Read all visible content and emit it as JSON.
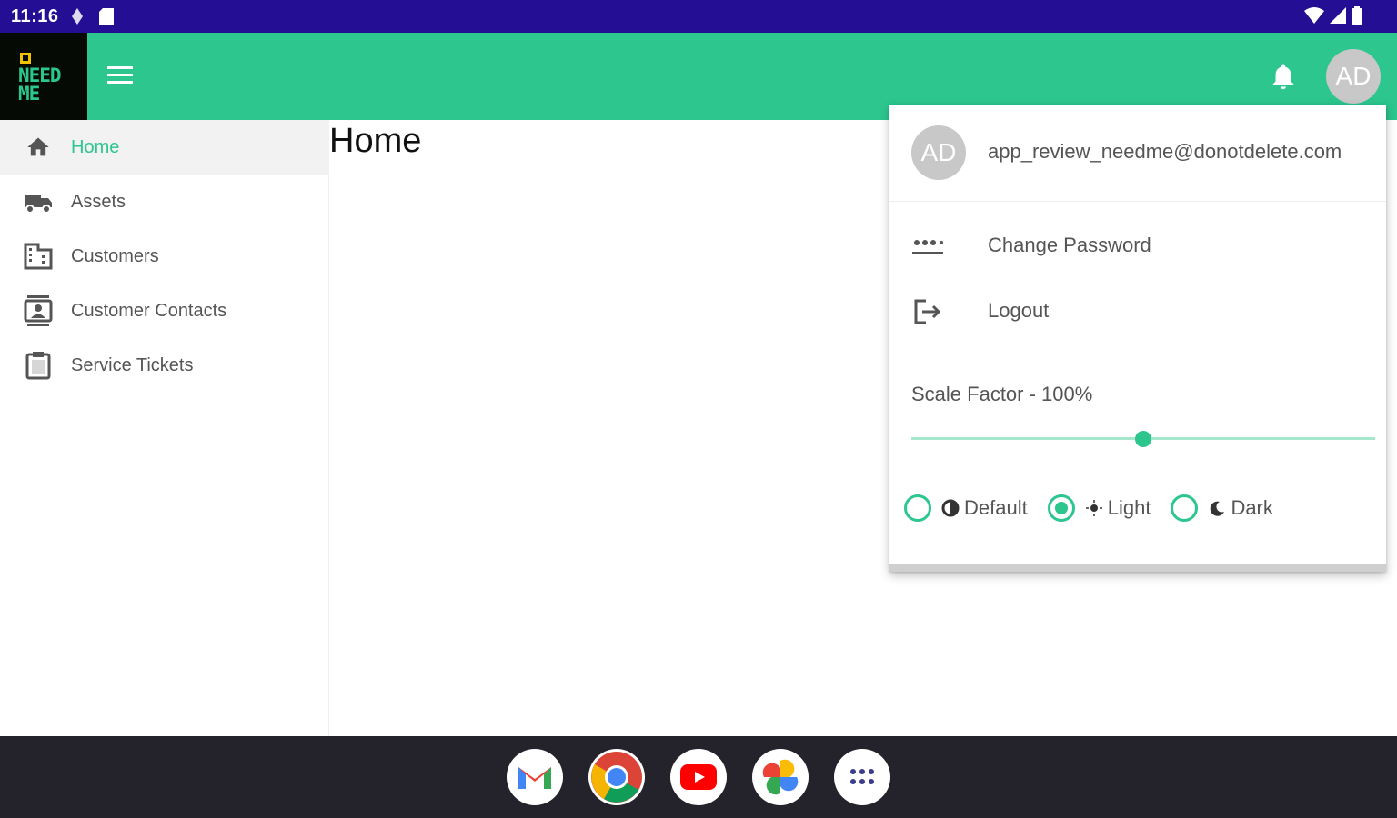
{
  "status_bar": {
    "time": "11:16",
    "icons": [
      "navigation-icon",
      "sd-card-icon",
      "wifi-icon",
      "signal-icon",
      "battery-icon"
    ]
  },
  "app_bar": {
    "logo_text_top": "NEED",
    "logo_text_bottom": "ME",
    "avatar_initials": "AD",
    "accent_color": "#2cc68e"
  },
  "sidebar": {
    "items": [
      {
        "label": "Home",
        "icon": "home-icon",
        "active": true
      },
      {
        "label": "Assets",
        "icon": "truck-icon",
        "active": false
      },
      {
        "label": "Customers",
        "icon": "building-icon",
        "active": false
      },
      {
        "label": "Customer Contacts",
        "icon": "contact-card-icon",
        "active": false
      },
      {
        "label": "Service Tickets",
        "icon": "clipboard-icon",
        "active": false
      }
    ]
  },
  "main": {
    "title": "Home"
  },
  "account_menu": {
    "avatar_initials": "AD",
    "email": "app_review_needme@donotdelete.com",
    "items": [
      {
        "label": "Change Password",
        "icon": "password-icon"
      },
      {
        "label": "Logout",
        "icon": "logout-icon"
      }
    ],
    "scale_label": "Scale Factor - 100%",
    "scale_value_fraction": 0.5,
    "themes": [
      {
        "label": "Default",
        "icon": "contrast-icon",
        "selected": false
      },
      {
        "label": "Light",
        "icon": "sun-icon",
        "selected": true
      },
      {
        "label": "Dark",
        "icon": "moon-icon",
        "selected": false
      }
    ]
  },
  "taskbar": {
    "apps": [
      "gmail-icon",
      "chrome-icon",
      "youtube-icon",
      "photos-icon",
      "app-drawer-icon"
    ]
  }
}
